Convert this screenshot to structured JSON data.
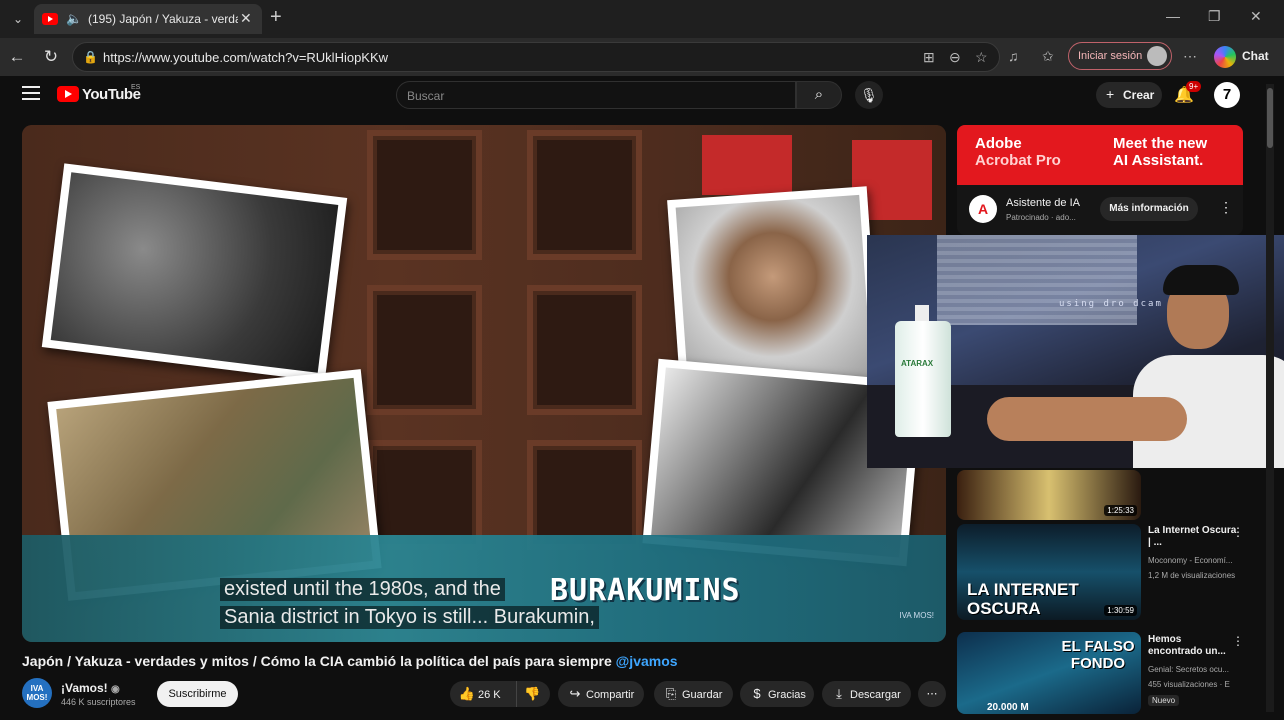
{
  "browser": {
    "tab_title": "(195) Japón / Yakuza - verdad",
    "url": "https://www.youtube.com/watch?v=RUklHiopKKw",
    "signin_label": "Iniciar sesión",
    "chat_label": "Chat",
    "icons": [
      "tab-list-icon",
      "speaker-icon",
      "close-icon",
      "plus-icon",
      "back-icon",
      "reload-icon",
      "lock-icon",
      "app-icon",
      "zoom-icon",
      "star-icon",
      "music-icon",
      "favorites-icon",
      "more-icon",
      "minimize-icon",
      "maximize-icon",
      "window-close-icon"
    ]
  },
  "yt_header": {
    "logo_text": "YouTube",
    "country_code": "ES",
    "search_placeholder": "Buscar",
    "create_label": "Crear",
    "notification_count": "9+",
    "account_initial": "7"
  },
  "player": {
    "subtitle_line1": "existed until the 1980s, and the",
    "subtitle_line2": "Sania district in Tokyo is still...  Burakumin,",
    "overlay_word": "BURAKUMINS",
    "watermark": "IVA MOS!"
  },
  "video": {
    "title": "Japón / Yakuza - verdades y mitos / Cómo la CIA cambió la política del país para siempre",
    "title_tag": "@jvamos",
    "channel_name": "¡Vamos!",
    "channel_subs": "446 K suscriptores",
    "channel_avatar": "IVA MOS!",
    "subscribe_label": "Suscribirme",
    "likes": "26 K",
    "share_label": "Compartir",
    "save_label": "Guardar",
    "thanks_label": "Gracias",
    "download_label": "Descargar"
  },
  "ad": {
    "banner_left_1": "Adobe",
    "banner_left_2": "Acrobat Pro",
    "banner_right_1": "Meet the new",
    "banner_right_2": "AI Assistant.",
    "title": "Asistente de IA",
    "sponsor": "Patrocinado · ado...",
    "cta": "Más información",
    "brand_color": "#e3181e"
  },
  "webcam": {
    "overlay_text": "using dro dcam pro",
    "bottle_label": "ATARAX"
  },
  "recommendations": [
    {
      "duration": "1:25:33"
    },
    {
      "thumb_text": "LA INTERNET OSCURA",
      "duration": "1:30:59",
      "title": "La Internet Oscura | ...",
      "channel": "Moconomy - Economí...",
      "views": "1,2 M de visualizaciones"
    },
    {
      "thumb_text": "EL FALSO FONDO",
      "thumb_caption": "20.000 M",
      "title": "Hemos encontrado un...",
      "channel": "Genial: Secretos ocu...",
      "views": "455 visualizaciones · E",
      "badge": "Nuevo"
    }
  ]
}
